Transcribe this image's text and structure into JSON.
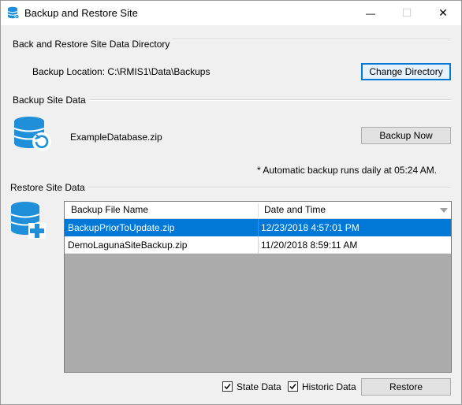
{
  "window": {
    "title": "Backup and Restore Site",
    "minimize_glyph": "—",
    "maximize_glyph": "☐",
    "close_glyph": "✕"
  },
  "directory_group": {
    "title": "Back and Restore Site Data Directory",
    "location_label": "Backup Location: C:\\RMIS1\\Data\\Backups",
    "change_button": "Change Directory"
  },
  "backup_group": {
    "title": "Backup Site Data",
    "icon": "database-backup-icon",
    "file_name": "ExampleDatabase.zip",
    "backup_button": "Backup Now",
    "note": "* Automatic backup runs daily at 05:24 AM."
  },
  "restore_group": {
    "title": "Restore Site Data",
    "icon": "database-add-icon",
    "columns": [
      "Backup File Name",
      "Date and Time"
    ],
    "rows": [
      {
        "file": "BackupPriorToUpdate.zip",
        "date": "12/23/2018 4:57:01 PM",
        "selected": true
      },
      {
        "file": "DemoLagunaSiteBackup.zip",
        "date": "11/20/2018 8:59:11 AM",
        "selected": false
      }
    ],
    "state_data_label": "State Data",
    "state_data_checked": true,
    "historic_data_label": "Historic Data",
    "historic_data_checked": true,
    "restore_button": "Restore"
  },
  "colors": {
    "accent": "#0078d7",
    "icon_blue": "#1e8fd8",
    "selection": "#0078d7"
  }
}
